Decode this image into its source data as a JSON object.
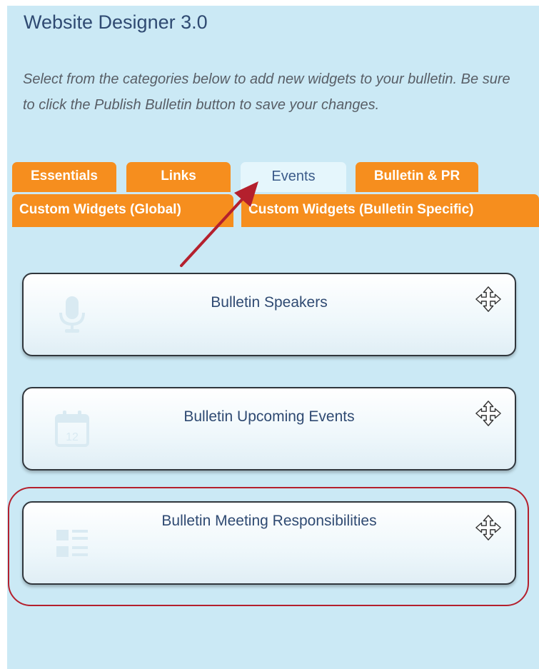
{
  "header": {
    "title": "Website Designer 3.0"
  },
  "instructions": "Select from the categories below to add new widgets to your bulletin. Be sure to click the Publish Bulletin button to save your changes.",
  "tabs": [
    {
      "label": "Essentials",
      "active": false
    },
    {
      "label": "Links",
      "active": false
    },
    {
      "label": "Events",
      "active": true
    },
    {
      "label": "Bulletin & PR",
      "active": false
    },
    {
      "label": "Custom Widgets (Global)",
      "active": false
    },
    {
      "label": "Custom Widgets (Bulletin Specific)",
      "active": false
    }
  ],
  "widgets": [
    {
      "label": "Bulletin Speakers",
      "icon": "microphone-icon"
    },
    {
      "label": "Bulletin Upcoming Events",
      "icon": "calendar-icon",
      "icon_text": "12"
    },
    {
      "label": "Bulletin Meeting Responsibilities",
      "icon": "list-icon"
    }
  ],
  "colors": {
    "panel_background": "#cbe9f5",
    "tab_orange": "#f68e1e",
    "active_tab": "#e5f6fc",
    "title_blue": "#2f4a72",
    "annotation_red": "#b4202d"
  }
}
